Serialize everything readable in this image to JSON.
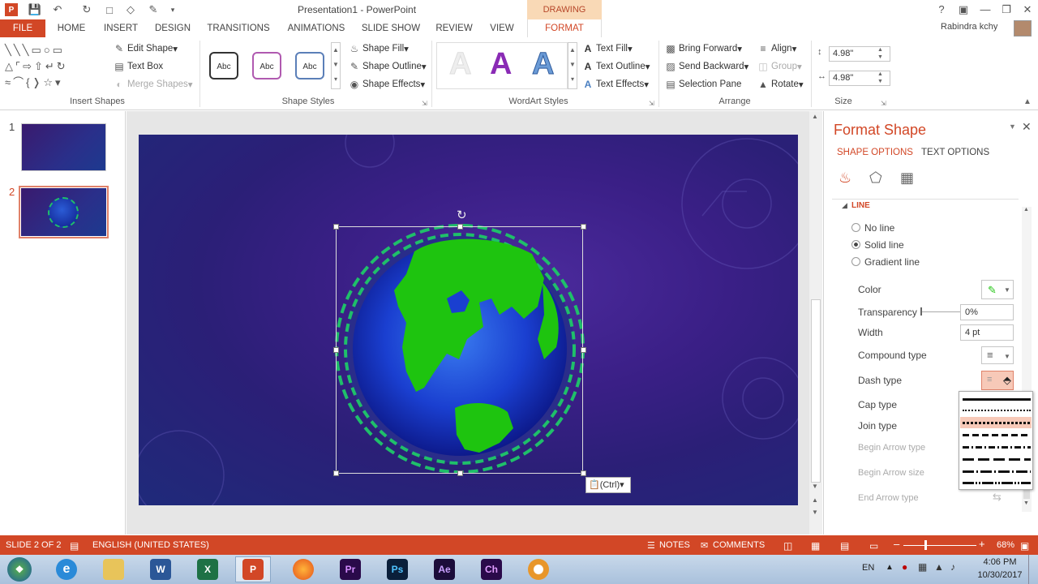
{
  "window": {
    "title": "Presentation1 - PowerPoint",
    "context_tab_group": "DRAWING TOOLS",
    "help": "?",
    "user": "Rabindra kchy"
  },
  "tabs": [
    "FILE",
    "HOME",
    "INSERT",
    "DESIGN",
    "TRANSITIONS",
    "ANIMATIONS",
    "SLIDE SHOW",
    "REVIEW",
    "VIEW",
    "FORMAT"
  ],
  "ribbon": {
    "insert_shapes": {
      "label": "Insert Shapes",
      "edit_shape": "Edit Shape",
      "text_box": "Text Box",
      "merge_shapes": "Merge Shapes"
    },
    "shape_styles": {
      "label": "Shape Styles",
      "sample": "Abc",
      "fill": "Shape Fill",
      "outline": "Shape Outline",
      "effects": "Shape Effects"
    },
    "wordart_styles": {
      "label": "WordArt Styles",
      "sample": "A",
      "text_fill": "Text Fill",
      "text_outline": "Text Outline",
      "text_effects": "Text Effects"
    },
    "arrange": {
      "label": "Arrange",
      "bring_forward": "Bring Forward",
      "send_backward": "Send Backward",
      "selection_pane": "Selection Pane",
      "align": "Align",
      "group": "Group",
      "rotate": "Rotate"
    },
    "size": {
      "label": "Size",
      "height": "4.98\"",
      "width": "4.98\""
    }
  },
  "slides": [
    {
      "number": "1"
    },
    {
      "number": "2"
    }
  ],
  "paste_options": "(Ctrl)",
  "format_pane": {
    "title": "Format Shape",
    "tab_shape": "SHAPE OPTIONS",
    "tab_text": "TEXT OPTIONS",
    "section": "LINE",
    "no_line": "No line",
    "solid_line": "Solid line",
    "gradient_line": "Gradient line",
    "color": "Color",
    "transparency": "Transparency",
    "transparency_value": "0%",
    "width": "Width",
    "width_value": "4 pt",
    "compound_type": "Compound type",
    "dash_type": "Dash type",
    "cap_type": "Cap type",
    "join_type": "Join type",
    "begin_arrow_type": "Begin Arrow type",
    "begin_arrow_size": "Begin Arrow size",
    "end_arrow_type": "End Arrow type"
  },
  "status": {
    "slide": "SLIDE 2 OF 2",
    "language": "ENGLISH (UNITED STATES)",
    "notes": "NOTES",
    "comments": "COMMENTS",
    "zoom": "68%"
  },
  "taskbar": {
    "lang": "EN",
    "time": "4:06 PM",
    "date": "10/30/2017",
    "apps": [
      "Pr",
      "Ps",
      "Ae",
      "Ch"
    ]
  },
  "colors": {
    "accent": "#d24726",
    "globe_land": "#1ec40f",
    "ring": "#1fbf6a"
  }
}
